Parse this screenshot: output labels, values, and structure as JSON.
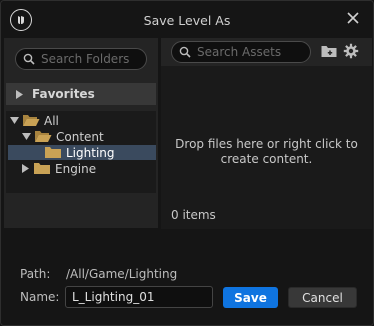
{
  "window": {
    "title": "Save Level As"
  },
  "left_panel": {
    "search_placeholder": "Search Folders",
    "favorites_label": "Favorites",
    "tree": [
      {
        "label": "All",
        "expanded": true,
        "selected": false
      },
      {
        "label": "Content",
        "expanded": true,
        "selected": false
      },
      {
        "label": "Lighting",
        "expanded": false,
        "selected": true
      },
      {
        "label": "Engine",
        "expanded": false,
        "selected": false
      }
    ]
  },
  "right_panel": {
    "search_placeholder": "Search Assets",
    "drop_text_line1": "Drop files here or right click to",
    "drop_text_line2": "create content.",
    "item_count": "0 items"
  },
  "footer": {
    "path_label": "Path:",
    "path_value": "/All/Game/Lighting",
    "name_label": "Name:",
    "name_value": "L_Lighting_01",
    "save_label": "Save",
    "cancel_label": "Cancel"
  },
  "colors": {
    "accent": "#0f74e0",
    "folder": "#c9a255",
    "selection": "#3a4a5e",
    "background": "#151515",
    "panel": "#242424"
  },
  "icons": [
    "unreal-logo-icon",
    "close-icon",
    "search-icon",
    "triangle-right-icon",
    "triangle-down-icon",
    "folder-icon",
    "folder-open-icon",
    "add-folder-icon",
    "gear-icon"
  ]
}
